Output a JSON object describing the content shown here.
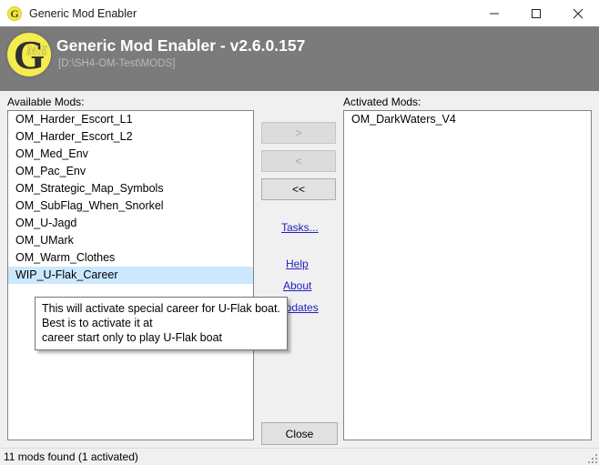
{
  "window": {
    "title": "Generic Mod Enabler",
    "icon": "gme-logo-icon",
    "controls": {
      "minimize": "minimize-icon",
      "maximize": "maximize-icon",
      "close": "close-icon"
    }
  },
  "header": {
    "title": "Generic Mod Enabler - v2.6.0.157",
    "path": "[D:\\SH4-OM-Test\\MODS]",
    "logo_letter": "G",
    "logo_badge": "ME",
    "bg_color": "#7b7b7b",
    "title_color": "#ffffff",
    "path_color": "#b9b9b9"
  },
  "available_panel": {
    "label": "Available Mods:",
    "items": [
      "OM_Harder_Escort_L1",
      "OM_Harder_Escort_L2",
      "OM_Med_Env",
      "OM_Pac_Env",
      "OM_Strategic_Map_Symbols",
      "OM_SubFlag_When_Snorkel",
      "OM_U-Jagd",
      "OM_UMark",
      "OM_Warm_Clothes",
      "WIP_U-Flak_Career"
    ],
    "selected_index": 9,
    "selection_color": "#cce8ff"
  },
  "activated_panel": {
    "label": "Activated Mods:",
    "items": [
      "OM_DarkWaters_V4"
    ]
  },
  "transfer_buttons": [
    {
      "label": ">",
      "name": "move-right-button",
      "enabled": false
    },
    {
      "label": "<",
      "name": "move-left-button",
      "enabled": false
    },
    {
      "label": "<<",
      "name": "move-all-left-button",
      "enabled": true
    }
  ],
  "links": [
    {
      "label": "Tasks...",
      "name": "tasks-link"
    },
    {
      "label": "Help",
      "name": "help-link"
    },
    {
      "label": "About",
      "name": "about-link"
    },
    {
      "label": "Updates",
      "name": "updates-link"
    }
  ],
  "link_color": "#2020c0",
  "close_button": {
    "label": "Close"
  },
  "tooltip": {
    "lines": [
      "This will activate special career for U-Flak boat.",
      "Best is to activate it at",
      "career start only to play U-Flak boat"
    ]
  },
  "statusbar": {
    "text": "11 mods found (1 activated)"
  }
}
